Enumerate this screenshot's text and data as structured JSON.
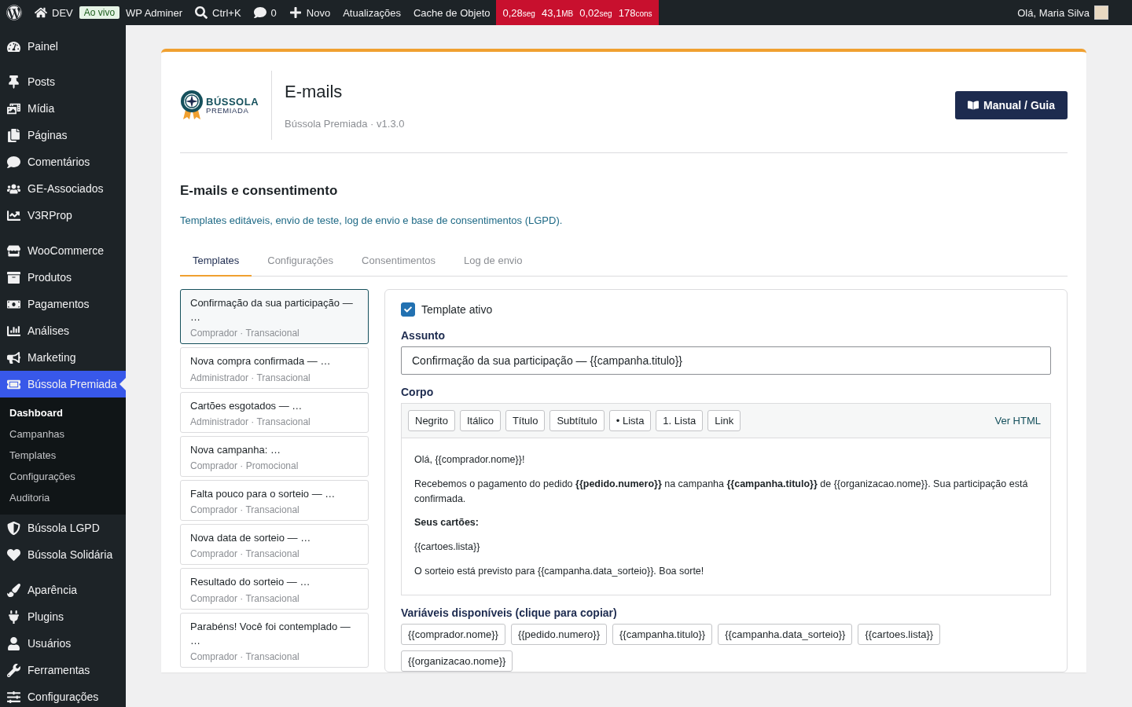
{
  "admin_bar": {
    "site": "DEV",
    "env_badge": "Ao vivo",
    "adminer": "WP Adminer",
    "search": "Ctrl+K",
    "comments": "0",
    "new": "Novo",
    "updates": "Atualizações",
    "cache": "Cache de Objeto",
    "metrics": [
      {
        "value": "0,28",
        "unit": "seg"
      },
      {
        "value": "43,1",
        "unit": "MB"
      },
      {
        "value": "0,02",
        "unit": "seg"
      },
      {
        "value": "178",
        "unit": "cons"
      }
    ],
    "greeting": "Olá, Maria Silva"
  },
  "sidebar": {
    "groups": [
      [
        {
          "label": "Painel",
          "selected": false
        }
      ],
      [
        {
          "label": "Posts",
          "selected": false
        },
        {
          "label": "Mídia",
          "selected": false
        },
        {
          "label": "Páginas",
          "selected": false
        },
        {
          "label": "Comentários",
          "selected": false
        },
        {
          "label": "GE-Associados",
          "selected": false
        },
        {
          "label": "V3RProp",
          "selected": false
        }
      ],
      [
        {
          "label": "WooCommerce",
          "selected": false
        },
        {
          "label": "Produtos",
          "selected": false
        },
        {
          "label": "Pagamentos",
          "selected": false
        },
        {
          "label": "Análises",
          "selected": false
        },
        {
          "label": "Marketing",
          "selected": false
        },
        {
          "label": "Bússola Premiada",
          "selected": true,
          "children": [
            {
              "label": "Dashboard",
              "selected": true
            },
            {
              "label": "Campanhas",
              "selected": false
            },
            {
              "label": "Templates",
              "selected": false
            },
            {
              "label": "Configurações",
              "selected": false
            },
            {
              "label": "Auditoria",
              "selected": false
            }
          ]
        },
        {
          "label": "Bússola LGPD",
          "selected": false
        },
        {
          "label": "Bússola Solidária",
          "selected": false
        }
      ],
      [
        {
          "label": "Aparência",
          "selected": false
        },
        {
          "label": "Plugins",
          "selected": false
        },
        {
          "label": "Usuários",
          "selected": false
        },
        {
          "label": "Ferramentas",
          "selected": false
        },
        {
          "label": "Configurações",
          "selected": false
        }
      ]
    ]
  },
  "header": {
    "logo_top": "BÚSSOLA",
    "logo_bottom": "PREMIADA",
    "title": "E-mails",
    "subtitle": "Bússola Premiada · v1.3.0",
    "manual_button": "Manual / Guia"
  },
  "section": {
    "title": "E-mails e consentimento",
    "description": "Templates editáveis, envio de teste, log de envio e base de consentimentos (LGPD)."
  },
  "tabs": [
    {
      "label": "Templates",
      "selected": true
    },
    {
      "label": "Configurações",
      "selected": false
    },
    {
      "label": "Consentimentos",
      "selected": false
    },
    {
      "label": "Log de envio",
      "selected": false
    }
  ],
  "templates": [
    {
      "title": "Confirmação da sua participação — …",
      "meta": "Comprador · Transacional",
      "selected": true
    },
    {
      "title": "Nova compra confirmada — …",
      "meta": "Administrador · Transacional",
      "selected": false
    },
    {
      "title": "Cartões esgotados — …",
      "meta": "Administrador · Transacional",
      "selected": false
    },
    {
      "title": "Nova campanha: …",
      "meta": "Comprador · Promocional",
      "selected": false
    },
    {
      "title": "Falta pouco para o sorteio — …",
      "meta": "Comprador · Transacional",
      "selected": false
    },
    {
      "title": "Nova data de sorteio — …",
      "meta": "Comprador · Transacional",
      "selected": false
    },
    {
      "title": "Resultado do sorteio — …",
      "meta": "Comprador · Transacional",
      "selected": false
    },
    {
      "title": "Parabéns! Você foi contemplado — …",
      "meta": "Comprador · Transacional",
      "selected": false
    }
  ],
  "editor": {
    "active": {
      "label": "Template ativo",
      "checked": true
    },
    "subject_label": "Assunto",
    "subject": "Confirmação da sua participação — {{campanha.titulo}}",
    "body_label": "Corpo",
    "toolbar": [
      "Negrito",
      "Itálico",
      "Título",
      "Subtítulo",
      "• Lista",
      "1. Lista",
      "Link"
    ],
    "html_link": "Ver HTML",
    "body": [
      {
        "kind": "text",
        "text": "Olá, {{comprador.nome}}!"
      },
      {
        "kind": "text",
        "text": "Recebemos o pagamento do pedido **{{pedido.numero}}** na campanha **{{campanha.titulo}}** de {{organizacao.nome}}. Sua participação está confirmada."
      },
      {
        "kind": "heading",
        "text": "Seus cartões:"
      },
      {
        "kind": "text",
        "text": " {{cartoes.lista}}"
      },
      {
        "kind": "text",
        "text": "O sorteio está previsto para {{campanha.data_sorteio}}. Boa sorte!"
      }
    ],
    "variables_label": "Variáveis disponíveis (clique para copiar)",
    "variables": [
      "{{comprador.nome}}",
      "{{pedido.numero}}",
      "{{campanha.titulo}}",
      "{{campanha.data_sorteio}}",
      "{{cartoes.lista}}",
      "{{organizacao.nome}}"
    ]
  }
}
